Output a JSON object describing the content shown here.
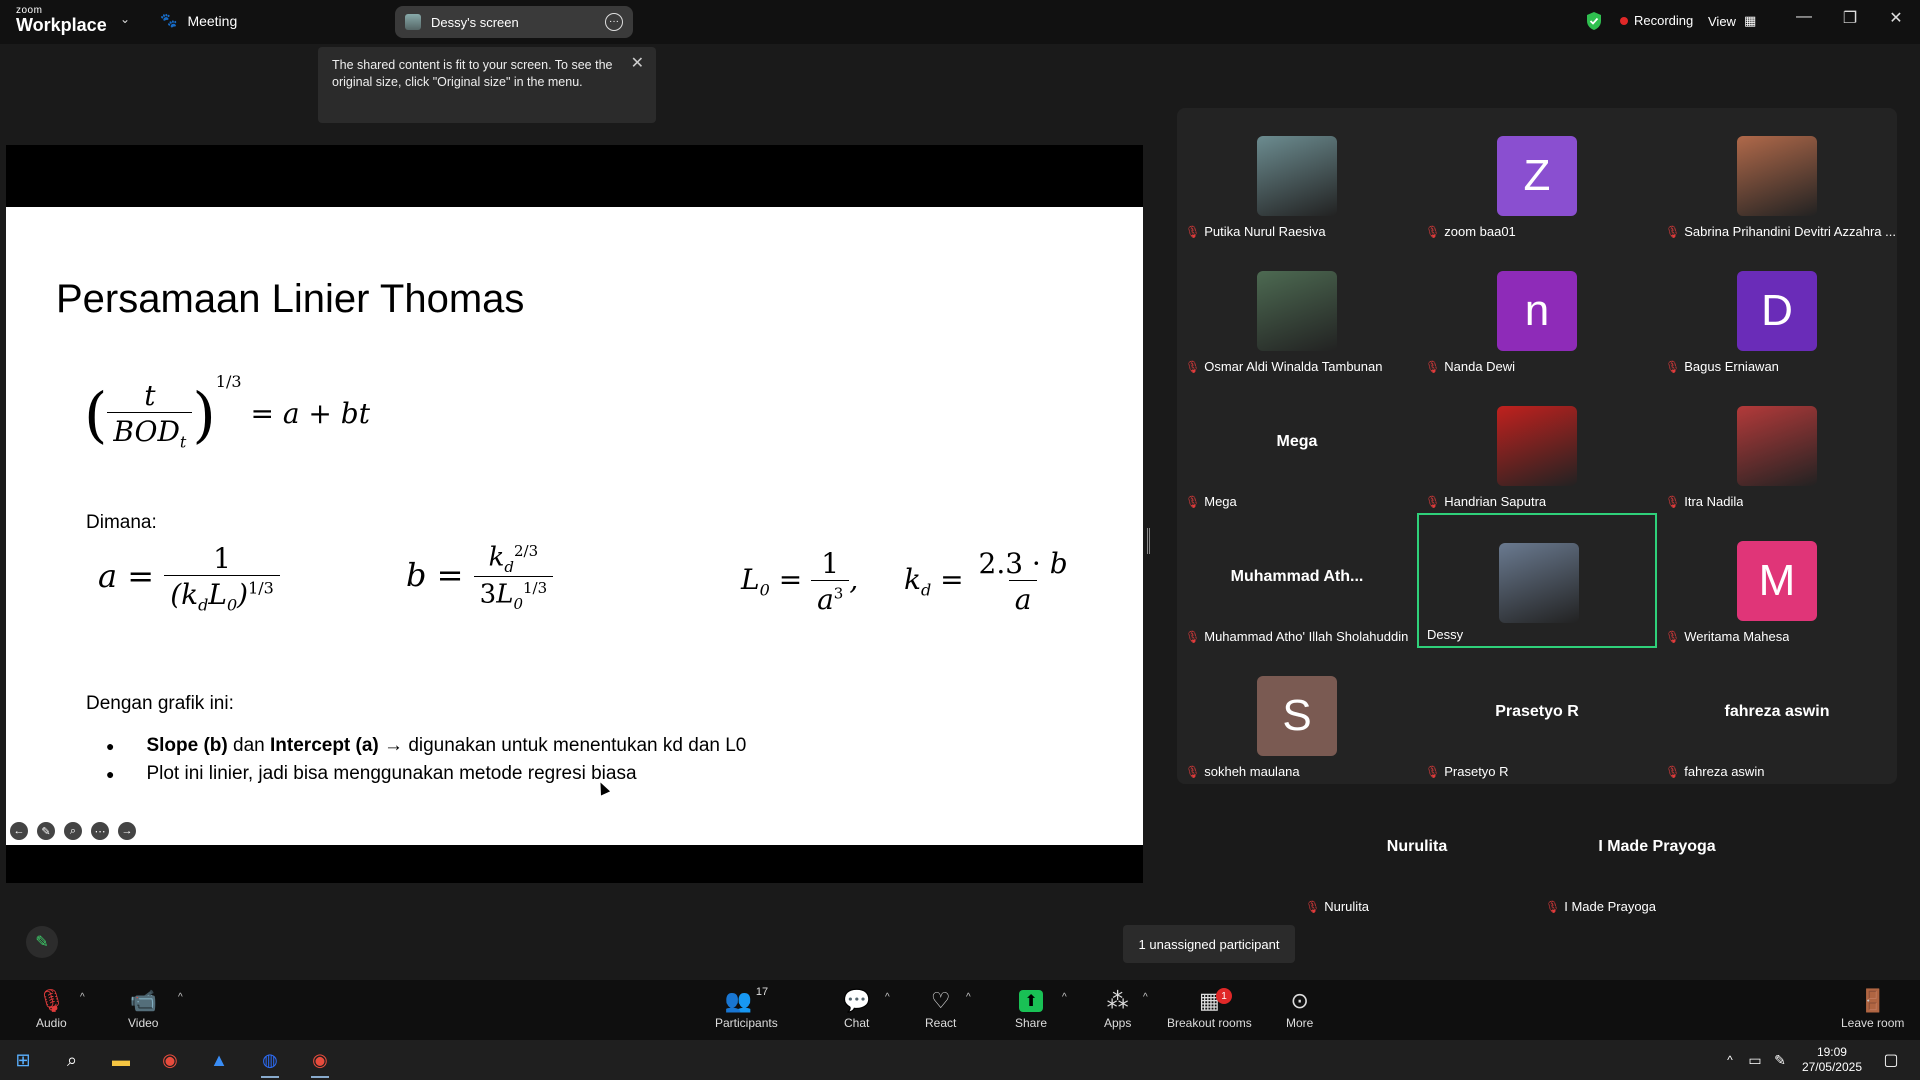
{
  "titlebar": {
    "logo_top": "zoom",
    "logo_bottom": "Workplace",
    "meeting_label": "Meeting",
    "screen_pill": "Dessy's screen",
    "recording_label": "Recording",
    "view_label": "View"
  },
  "tooltip": {
    "text": "The shared content is fit to your screen. To see the original size, click \"Original size\" in the menu."
  },
  "slide": {
    "title": "Persamaan Linier Thomas",
    "dimana": "Dimana:",
    "dengan": "Dengan grafik ini:",
    "bullet1_bold1": "Slope (b)",
    "bullet1_mid": " dan ",
    "bullet1_bold2": "Intercept (a)",
    "bullet1_rest": " → digunakan untuk menentukan kd dan L0",
    "bullet2": "Plot ini linier, jadi bisa menggunakan metode regresi biasa"
  },
  "participants": [
    {
      "name": "Putika Nurul Raesiva",
      "type": "photo",
      "color": "#6c8c90"
    },
    {
      "name": "zoom baa01",
      "type": "letter",
      "letter": "Z",
      "color": "#8a4fd0"
    },
    {
      "name": "Sabrina Prihandini Devitri Azzahra ...",
      "type": "photo",
      "color": "#b0694a"
    },
    {
      "name": "Osmar Aldi Winalda Tambunan",
      "type": "photo",
      "color": "#4d6a52"
    },
    {
      "name": "Nanda Dewi",
      "type": "letter",
      "letter": "n",
      "color": "#8e2bb8"
    },
    {
      "name": "Bagus Erniawan",
      "type": "letter",
      "letter": "D",
      "color": "#6a2cb8"
    },
    {
      "name": "Mega",
      "type": "text",
      "big": "Mega"
    },
    {
      "name": "Handrian Saputra",
      "type": "photo",
      "color": "#c0211e"
    },
    {
      "name": "Itra Nadila",
      "type": "photo",
      "color": "#b33a3a"
    },
    {
      "name": "Muhammad Atho' Illah Sholahuddin",
      "type": "text",
      "big": "Muhammad  Ath..."
    },
    {
      "name": "Dessy",
      "type": "photo",
      "color": "#6a7a90",
      "active": true
    },
    {
      "name": "Weritama Mahesa",
      "type": "letter",
      "letter": "M",
      "color": "#e03578"
    },
    {
      "name": "sokheh maulana",
      "type": "letter",
      "letter": "S",
      "color": "#7a5a52"
    },
    {
      "name": "Prasetyo R",
      "type": "text",
      "big": "Prasetyo R"
    },
    {
      "name": "fahreza aswin",
      "type": "text",
      "big": "fahreza aswin"
    },
    {
      "name": "Nurulita",
      "type": "text",
      "big": "Nurulita"
    },
    {
      "name": "I Made Prayoga",
      "type": "text",
      "big": "I Made Prayoga"
    }
  ],
  "unassigned": "1 unassigned participant",
  "toolbar": {
    "audio": "Audio",
    "video": "Video",
    "participants": "Participants",
    "participants_count": "17",
    "chat": "Chat",
    "react": "React",
    "share": "Share",
    "apps": "Apps",
    "breakout": "Breakout rooms",
    "breakout_badge": "1",
    "more": "More",
    "leave": "Leave room"
  },
  "taskbar": {
    "time": "19:09",
    "date": "27/05/2025"
  }
}
